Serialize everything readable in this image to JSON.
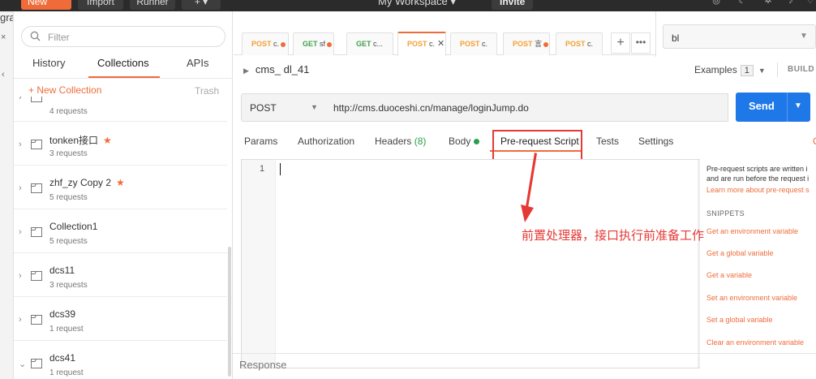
{
  "topbar": {
    "new_label": "New",
    "import_label": "Import",
    "runner_label": "Runner",
    "add_label": "+ ▾",
    "workspace_label": "My Workspace ▾",
    "invite_label": "Invite"
  },
  "leftedge": {
    "text_fragment": "gra",
    "close": "×",
    "chevron": "‹"
  },
  "sidebar": {
    "search_placeholder": "Filter",
    "tabs": [
      "History",
      "Collections",
      "APIs"
    ],
    "new_collection": "+ New Collection",
    "trash": "Trash",
    "collections": [
      {
        "name": "",
        "requests": "4 requests",
        "starred": false
      },
      {
        "name": "tonken接口",
        "requests": "3 requests",
        "starred": true
      },
      {
        "name": "zhf_zy Copy 2",
        "requests": "5 requests",
        "starred": true
      },
      {
        "name": "Collection1",
        "requests": "5 requests",
        "starred": false
      },
      {
        "name": "dcs11",
        "requests": "3 requests",
        "starred": false
      },
      {
        "name": "dcs39",
        "requests": "1 request",
        "starred": false
      },
      {
        "name": "dcs41",
        "requests": "1 request",
        "starred": false
      }
    ]
  },
  "request_tabs": [
    {
      "method": "POST",
      "name": "c.",
      "dot": true
    },
    {
      "method": "GET",
      "name": "sf",
      "dot": true
    },
    {
      "method": "GET",
      "name": "c...",
      "dot": false
    },
    {
      "method": "POST",
      "name": "c.",
      "dot": false,
      "active": true,
      "close": "✕"
    },
    {
      "method": "POST",
      "name": "c.",
      "dot": false
    },
    {
      "method": "POST",
      "name": "言",
      "dot": true
    },
    {
      "method": "POST",
      "name": "c.",
      "dot": false
    }
  ],
  "tab_controls": {
    "plus": "+",
    "more": "•••"
  },
  "environment": {
    "selected": "bl"
  },
  "request": {
    "title": "cms_ dl_41",
    "examples_label": "Examples",
    "examples_count": "1",
    "build_label": "BUILD",
    "method": "POST",
    "url": "http://cms.duoceshi.cn/manage/loginJump.do",
    "send_label": "Send"
  },
  "subtabs": {
    "params": "Params",
    "authorization": "Authorization",
    "headers": "Headers",
    "headers_count": "(8)",
    "body": "Body",
    "prerequest": "Pre-request Script",
    "tests": "Tests",
    "settings": "Settings",
    "cookies": "C"
  },
  "editor": {
    "line_number": "1"
  },
  "annotation": {
    "text": "前置处理器，接口执行前准备工作"
  },
  "right_panel": {
    "desc_line1": "Pre-request scripts are written i",
    "desc_line2": "and are run before the request i",
    "learn_more": "Learn more about pre-request s",
    "snippets_title": "SNIPPETS",
    "snippets": [
      "Get an environment variable",
      "Get a global variable",
      "Get a variable",
      "Set an environment variable",
      "Set a global variable",
      "Clear an environment variable"
    ]
  },
  "response": {
    "label": "Response"
  },
  "colors": {
    "accent": "#ef6c3a",
    "send_blue": "#1f78e8",
    "annotation_red": "#e53935",
    "get_green": "#40a24b",
    "post_orange": "#f3a034"
  }
}
